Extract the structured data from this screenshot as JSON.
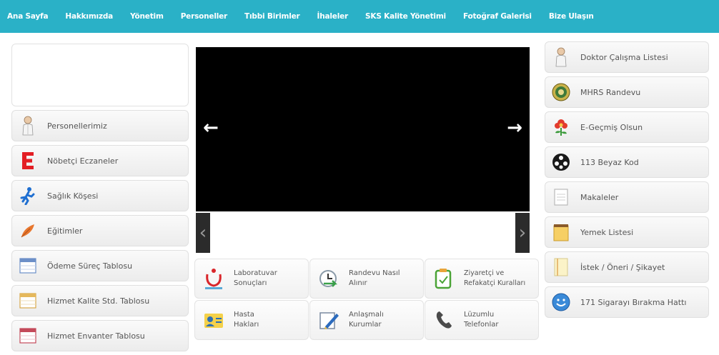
{
  "nav": {
    "items": [
      "Ana Sayfa",
      "Hakkımızda",
      "Yönetim",
      "Personeller",
      "Tıbbi Birimler",
      "İhaleler",
      "SKS Kalite Yönetimi",
      "Fotoğraf Galerisi",
      "Bize Ulaşın"
    ]
  },
  "left": {
    "items": [
      {
        "label": "Personellerimiz",
        "icon": "doctor-icon"
      },
      {
        "label": "Nöbetçi Eczaneler",
        "icon": "pharmacy-e-icon"
      },
      {
        "label": "Sağlık Köşesi",
        "icon": "runner-icon"
      },
      {
        "label": "Eğitimler",
        "icon": "feather-icon"
      },
      {
        "label": "Ödeme Süreç Tablosu",
        "icon": "table-icon"
      },
      {
        "label": "Hizmet Kalite Std. Tablosu",
        "icon": "table-icon"
      },
      {
        "label": "Hizmet Envanter Tablosu",
        "icon": "table-icon"
      }
    ]
  },
  "right": {
    "items": [
      {
        "label": "Doktor Çalışma Listesi",
        "icon": "doctor-icon"
      },
      {
        "label": "MHRS Randevu",
        "icon": "mhrs-seal-icon"
      },
      {
        "label": "E-Geçmiş Olsun",
        "icon": "flower-icon"
      },
      {
        "label": "113 Beyaz Kod",
        "icon": "white-code-icon"
      },
      {
        "label": "Makaleler",
        "icon": "document-icon"
      },
      {
        "label": "Yemek Listesi",
        "icon": "notepad-icon"
      },
      {
        "label": "İstek / Öneri / Şikayet",
        "icon": "paper-icon"
      },
      {
        "label": "171 Sigarayı Bırakma Hattı",
        "icon": "smile-icon"
      }
    ]
  },
  "slider": {
    "prev": "←",
    "next": "→",
    "thumb_prev": "‹",
    "thumb_next": "›"
  },
  "tiles": [
    {
      "line1": "Laboratuvar",
      "line2": "Sonuçları",
      "icon": "lab-results-icon"
    },
    {
      "line1": "Randevu Nasıl",
      "line2": "Alınır",
      "icon": "appointment-icon"
    },
    {
      "line1": "Ziyaretçi ve",
      "line2": "Refakatçi Kuralları",
      "icon": "visitor-icon"
    },
    {
      "line1": "Hasta",
      "line2": "Hakları",
      "icon": "patient-rights-icon"
    },
    {
      "line1": "Anlaşmalı",
      "line2": "Kurumlar",
      "icon": "pen-icon"
    },
    {
      "line1": "Lüzumlu",
      "line2": "Telefonlar",
      "icon": "phone-icon"
    }
  ]
}
